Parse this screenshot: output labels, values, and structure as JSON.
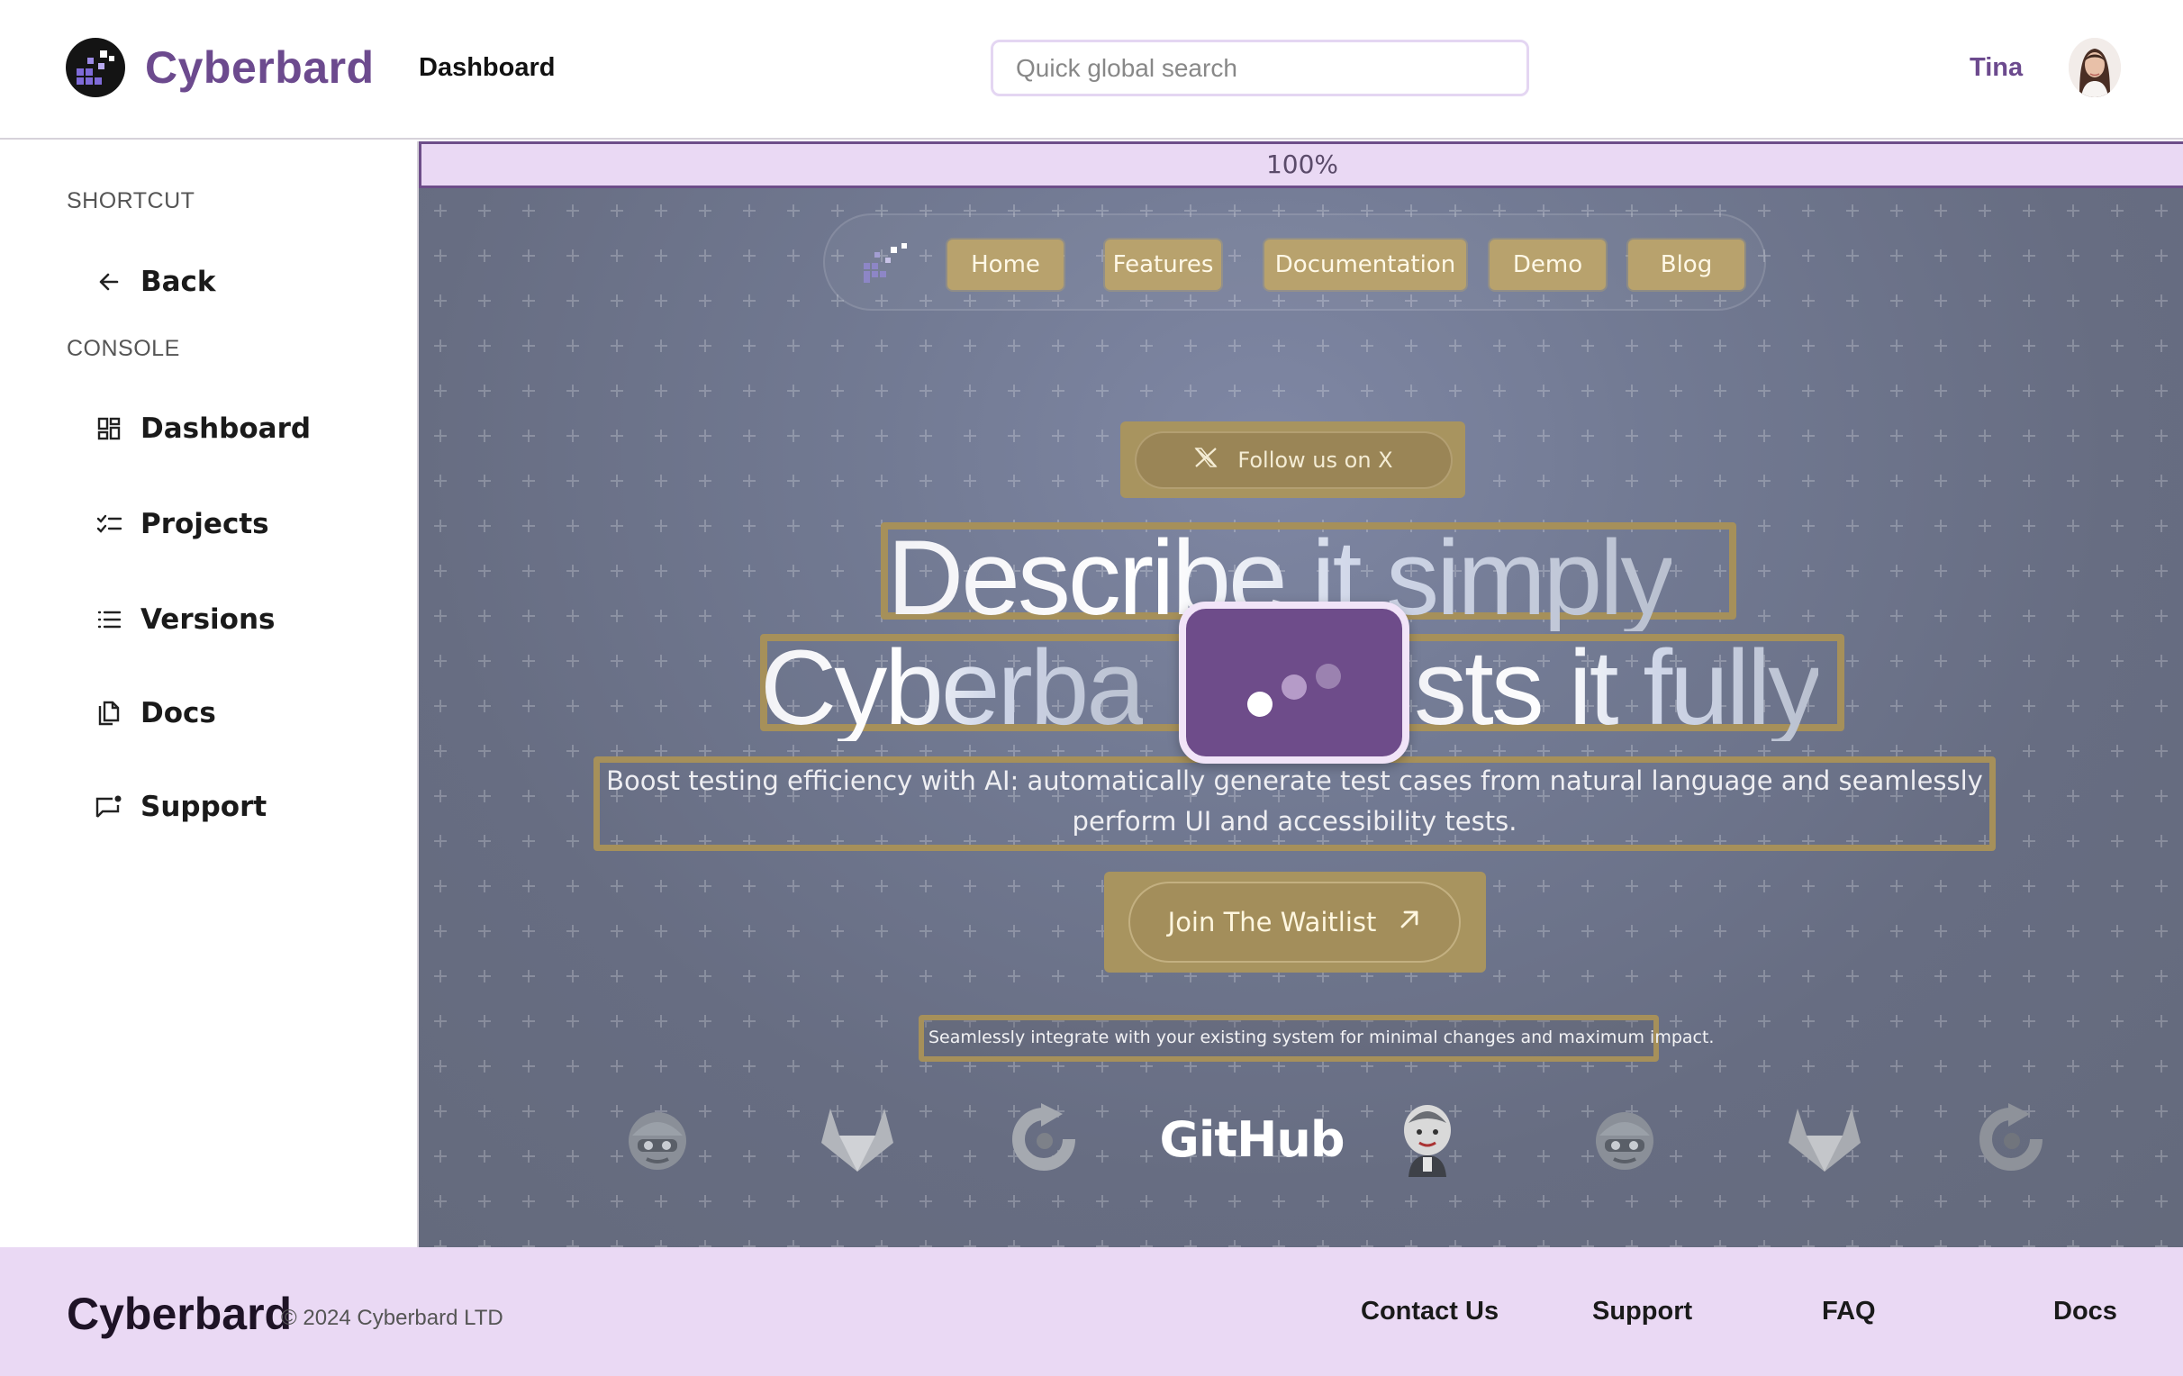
{
  "header": {
    "brand": "Cyberbard",
    "nav_dashboard": "Dashboard",
    "search_placeholder": "Quick global search",
    "user_name": "Tina"
  },
  "sidebar": {
    "shortcut_label": "SHORTCUT",
    "back_label": "Back",
    "console_label": "CONSOLE",
    "items": [
      {
        "label": "Dashboard",
        "icon": "dashboard-icon"
      },
      {
        "label": "Projects",
        "icon": "checklist-icon"
      },
      {
        "label": "Versions",
        "icon": "list-icon"
      },
      {
        "label": "Docs",
        "icon": "copy-icon"
      },
      {
        "label": "Support",
        "icon": "chat-icon"
      }
    ]
  },
  "preview": {
    "zoom": "100%",
    "nav": [
      "Home",
      "Features",
      "Documentation",
      "Demo",
      "Blog"
    ],
    "follow": "Follow us on X",
    "hero_line1": "Describe it simply",
    "hero_line2_left": "Cyberba",
    "hero_line2_right": "sts it fully",
    "subtitle": "Boost testing efficiency with AI: automatically generate test cases from natural language and seamlessly perform UI and accessibility tests.",
    "cta": "Join The Waitlist",
    "integrations_text": "Seamlessly integrate with your existing system for minimal changes and maximum impact.",
    "integration_logos": [
      "jenkins-helmet-logo",
      "gitlab-logo",
      "refresh-logo",
      "github-logo",
      "jenkins-logo",
      "jenkins-helmet-logo",
      "gitlab-logo",
      "refresh-logo"
    ],
    "github_word": "GitHub"
  },
  "colors": {
    "brand_purple": "#6c4a8e",
    "highlight_gold": "#a6905a",
    "zoom_bar_bg": "#ead9f4",
    "footer_bg": "#ead9f4",
    "loader_bg": "#6e4c8a"
  },
  "footer": {
    "brand": "Cyberbard",
    "copyright": "© 2024 Cyberbard LTD",
    "links": [
      "Contact Us",
      "Support",
      "FAQ",
      "Docs"
    ]
  }
}
